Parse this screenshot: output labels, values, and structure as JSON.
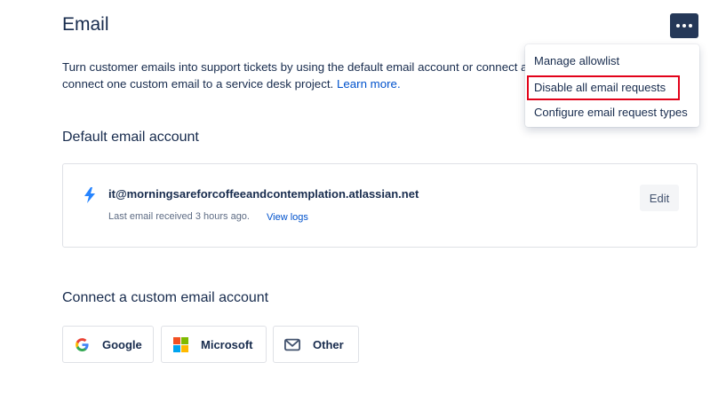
{
  "header": {
    "title": "Email",
    "more_icon": "more-horizontal-icon"
  },
  "description": {
    "line1": "Turn customer emails into support tickets by using the default email account or connect a",
    "line2": "connect one custom email to a service desk project.",
    "link": "Learn more."
  },
  "default_account": {
    "heading": "Default email account",
    "email": "it@morningsareforcoffeeandcontemplation.atlassian.net",
    "last_received": "Last email received 3 hours ago.",
    "view_logs": "View logs",
    "edit_label": "Edit",
    "icon": "lightning-bolt-icon"
  },
  "custom_account": {
    "heading": "Connect a custom email account",
    "providers": [
      {
        "label": "Google",
        "icon": "google-icon"
      },
      {
        "label": "Microsoft",
        "icon": "microsoft-icon"
      },
      {
        "label": "Other",
        "icon": "mail-icon"
      }
    ]
  },
  "menu": {
    "items": [
      {
        "label": "Manage allowlist"
      },
      {
        "label": "Disable all email requests",
        "highlighted": true
      },
      {
        "label": "Configure email request types"
      }
    ]
  },
  "colors": {
    "text": "#172B4D",
    "link": "#0052CC",
    "button_dark": "#253858",
    "highlight": "#E2021A"
  }
}
